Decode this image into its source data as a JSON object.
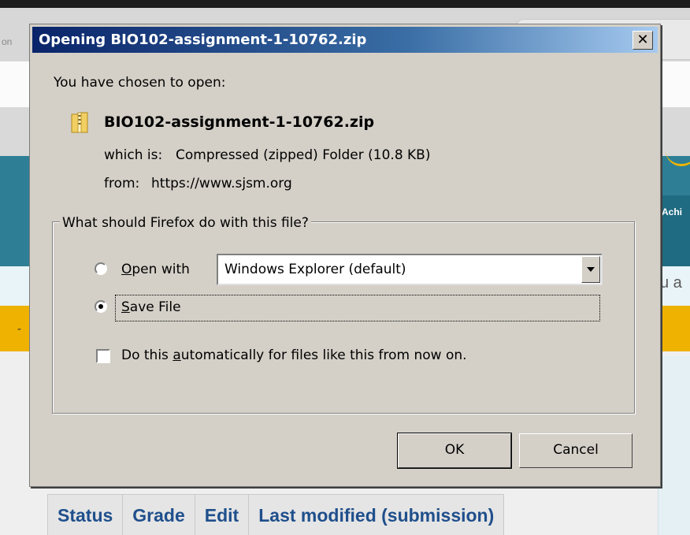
{
  "background": {
    "tab_text": "on",
    "nav_text": "Achi",
    "light_text": "u a",
    "dash_text": "-",
    "table_headers": [
      "Status",
      "Grade",
      "Edit",
      "Last modified (submission)"
    ]
  },
  "dialog": {
    "title": "Opening BIO102-assignment-1-10762.zip",
    "close_glyph": "✕",
    "intro": "You have chosen to open:",
    "file_icon": "zip-folder-icon",
    "file_name": "BIO102-assignment-1-10762.zip",
    "which_is_label": "which is:",
    "which_is_value": "Compressed (zipped) Folder (10.8 KB)",
    "from_label": "from:",
    "from_value": "https://www.sjsm.org",
    "group_label": "What should Firefox do with this file?",
    "open_with_pre": "",
    "open_with_access": "O",
    "open_with_post": "pen with",
    "open_with_value": "Windows Explorer (default)",
    "save_file_access": "S",
    "save_file_post": "ave File",
    "selected_option": "save_file",
    "auto_pre": "Do this ",
    "auto_access": "a",
    "auto_post": "utomatically for files like this from now on.",
    "auto_checked": false,
    "ok_label": "OK",
    "cancel_label": "Cancel"
  }
}
